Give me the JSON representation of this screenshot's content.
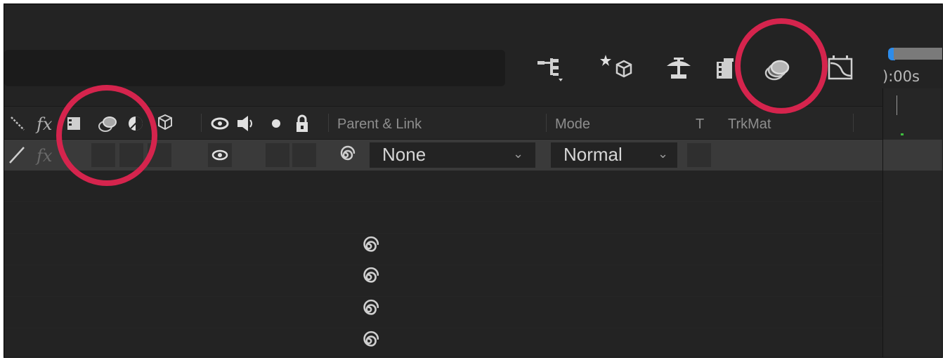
{
  "toolbar": {
    "icons": [
      "flowchart-icon",
      "draft-3d-icon",
      "motion-blur-master-icon",
      "frame-blending-icon",
      "shy-layers-icon",
      "graph-editor-icon"
    ]
  },
  "timeline": {
    "time_label": "):00s"
  },
  "columns": {
    "parent_link": "Parent & Link",
    "mode": "Mode",
    "t": "T",
    "trkmat": "TrkMat"
  },
  "layer": {
    "parent_value": "None",
    "mode_value": "Normal"
  },
  "highlight_color": "#d5244d",
  "accent_color": "#2d8ceb"
}
